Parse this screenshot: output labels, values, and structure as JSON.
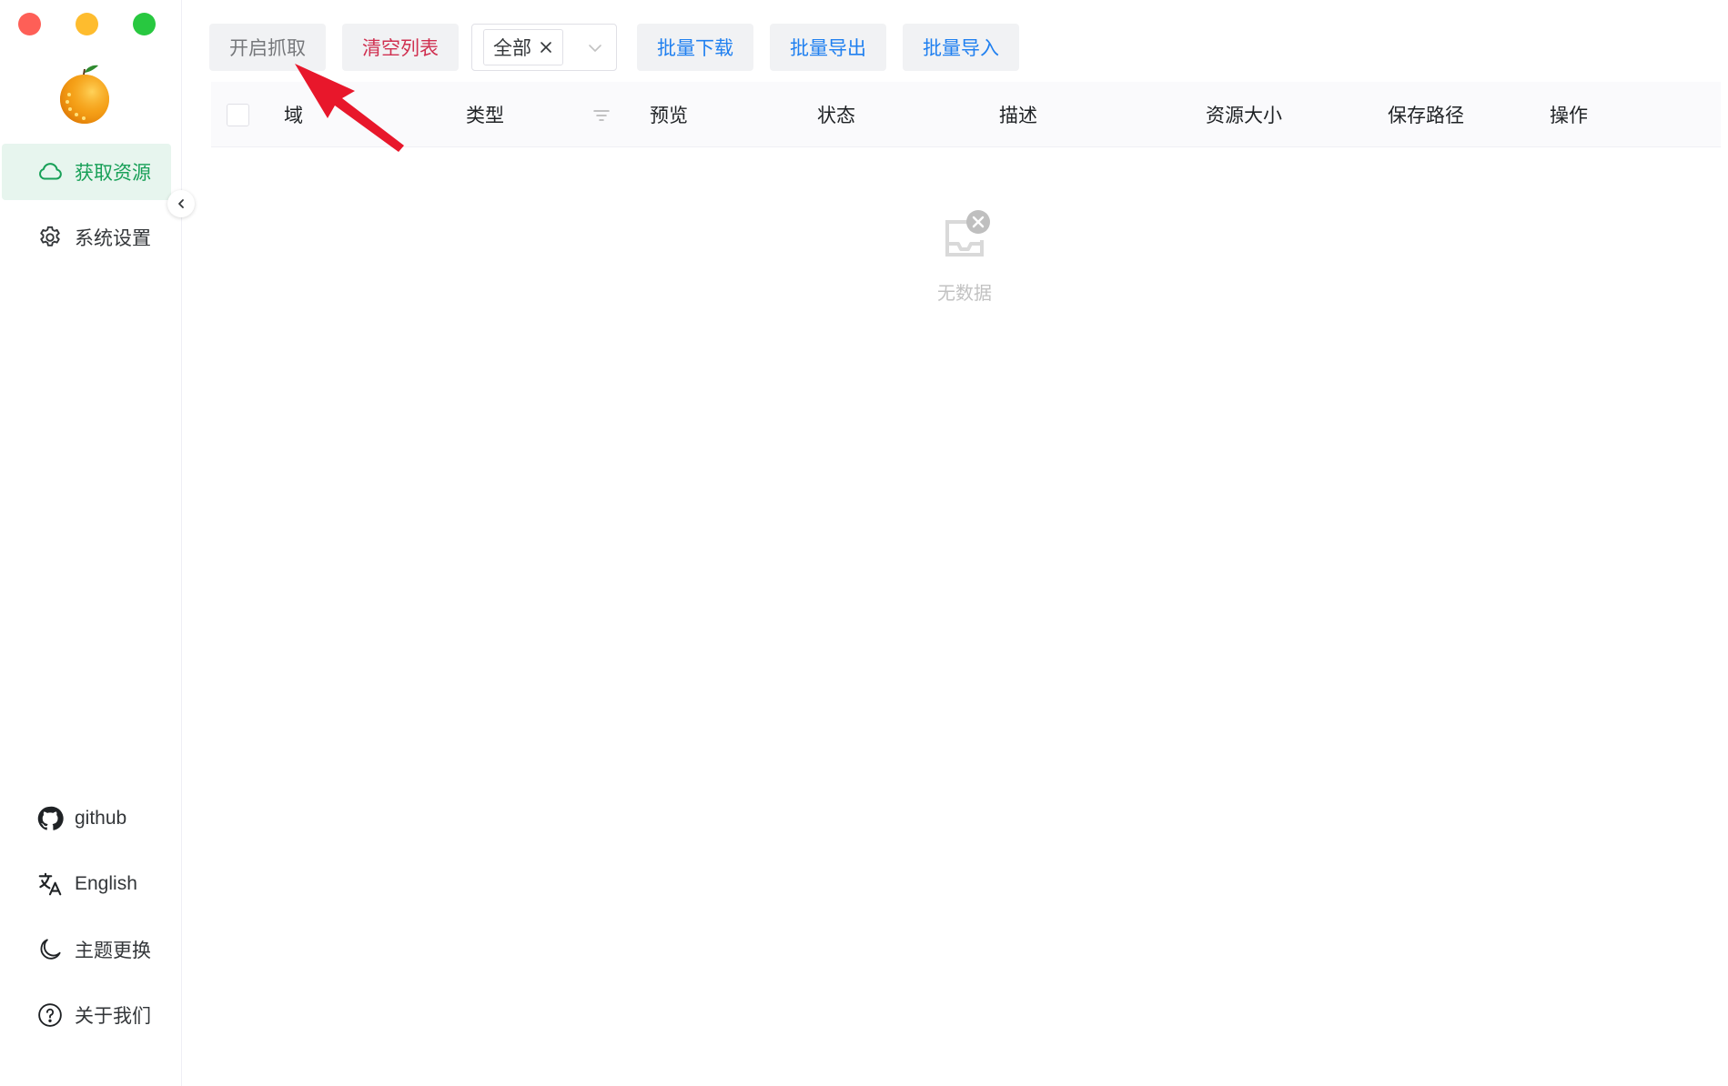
{
  "sidebar": {
    "nav": [
      {
        "label": "获取资源",
        "icon": "cloud-icon",
        "active": true
      },
      {
        "label": "系统设置",
        "icon": "gear-icon",
        "active": false
      }
    ],
    "bottom": [
      {
        "label": "github",
        "icon": "github-icon"
      },
      {
        "label": "English",
        "icon": "translate-icon"
      },
      {
        "label": "主题更换",
        "icon": "moon-icon"
      },
      {
        "label": "关于我们",
        "icon": "help-circle-icon"
      }
    ]
  },
  "toolbar": {
    "start_capture": "开启抓取",
    "clear_list": "清空列表",
    "filter_tag": "全部",
    "batch_download": "批量下载",
    "batch_export": "批量导出",
    "batch_import": "批量导入"
  },
  "table": {
    "columns": [
      "域",
      "类型",
      "预览",
      "状态",
      "描述",
      "资源大小",
      "保存路径",
      "操作"
    ],
    "empty_text": "无数据"
  },
  "colors": {
    "accent": "#18a058",
    "danger": "#d03050",
    "info": "#2080f0",
    "annotation": "#e8172b"
  }
}
